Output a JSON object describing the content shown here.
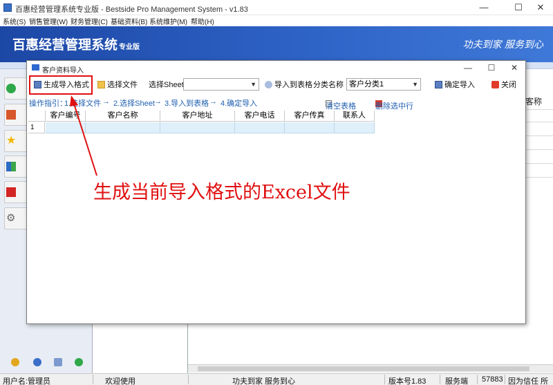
{
  "window": {
    "title": "百惠经营管理系统专业版 - Bestside Pro Management System - v1.83",
    "minimize": "—",
    "maximize": "☐",
    "close": "✕"
  },
  "menu": [
    "系统(S)",
    "销售管理(W)",
    "财务管理(C)",
    "基础资料(B)",
    "系统维护(M)",
    "帮助(H)"
  ],
  "banner": {
    "brand": "百惠经营管理系统",
    "edition": "专业版",
    "slogan": "功夫到家 服务到心"
  },
  "background_header": "客称",
  "dialog": {
    "title": "客户资料导入",
    "minimize": "—",
    "maximize": "☐",
    "close": "✕"
  },
  "toolbar": {
    "generate_format": "生成导入格式",
    "choose_file": "选择文件",
    "sheet_label": "选择Sheet",
    "sheet_value": "",
    "import_table": "导入到表格",
    "category_label": "分类名称",
    "category_value": "客户分类1",
    "confirm_import": "确定导入",
    "close": "关闭"
  },
  "guide": {
    "prefix": "操作指引：",
    "step1": "1.选择文件",
    "arrow": "→",
    "step2": "2.选择Sheet",
    "step3": "3.导入到表格",
    "step4": "4.确定导入",
    "clear_table": "清空表格",
    "delete_row": "删除选中行"
  },
  "grid": {
    "columns": [
      "客户编号",
      "客户名称",
      "客户地址",
      "客户电话",
      "客户传真",
      "联系人"
    ],
    "rows": [
      [
        "1",
        "",
        "",
        "",
        "",
        "",
        ""
      ]
    ]
  },
  "annotation": "生成当前导入格式的Excel文件",
  "status": {
    "user": "用户名:管理员",
    "welcome": "欢迎使用",
    "slogan": "功夫到家 服务到心",
    "version": "版本号1.83",
    "server_label": "服务端",
    "server_value": "57883",
    "note": "因为信任 所"
  },
  "colors": {
    "banner": "#2e63c6",
    "annotation": "#e01010",
    "guide_link": "#1f5fb0",
    "grid_row": "#dff0fa"
  }
}
